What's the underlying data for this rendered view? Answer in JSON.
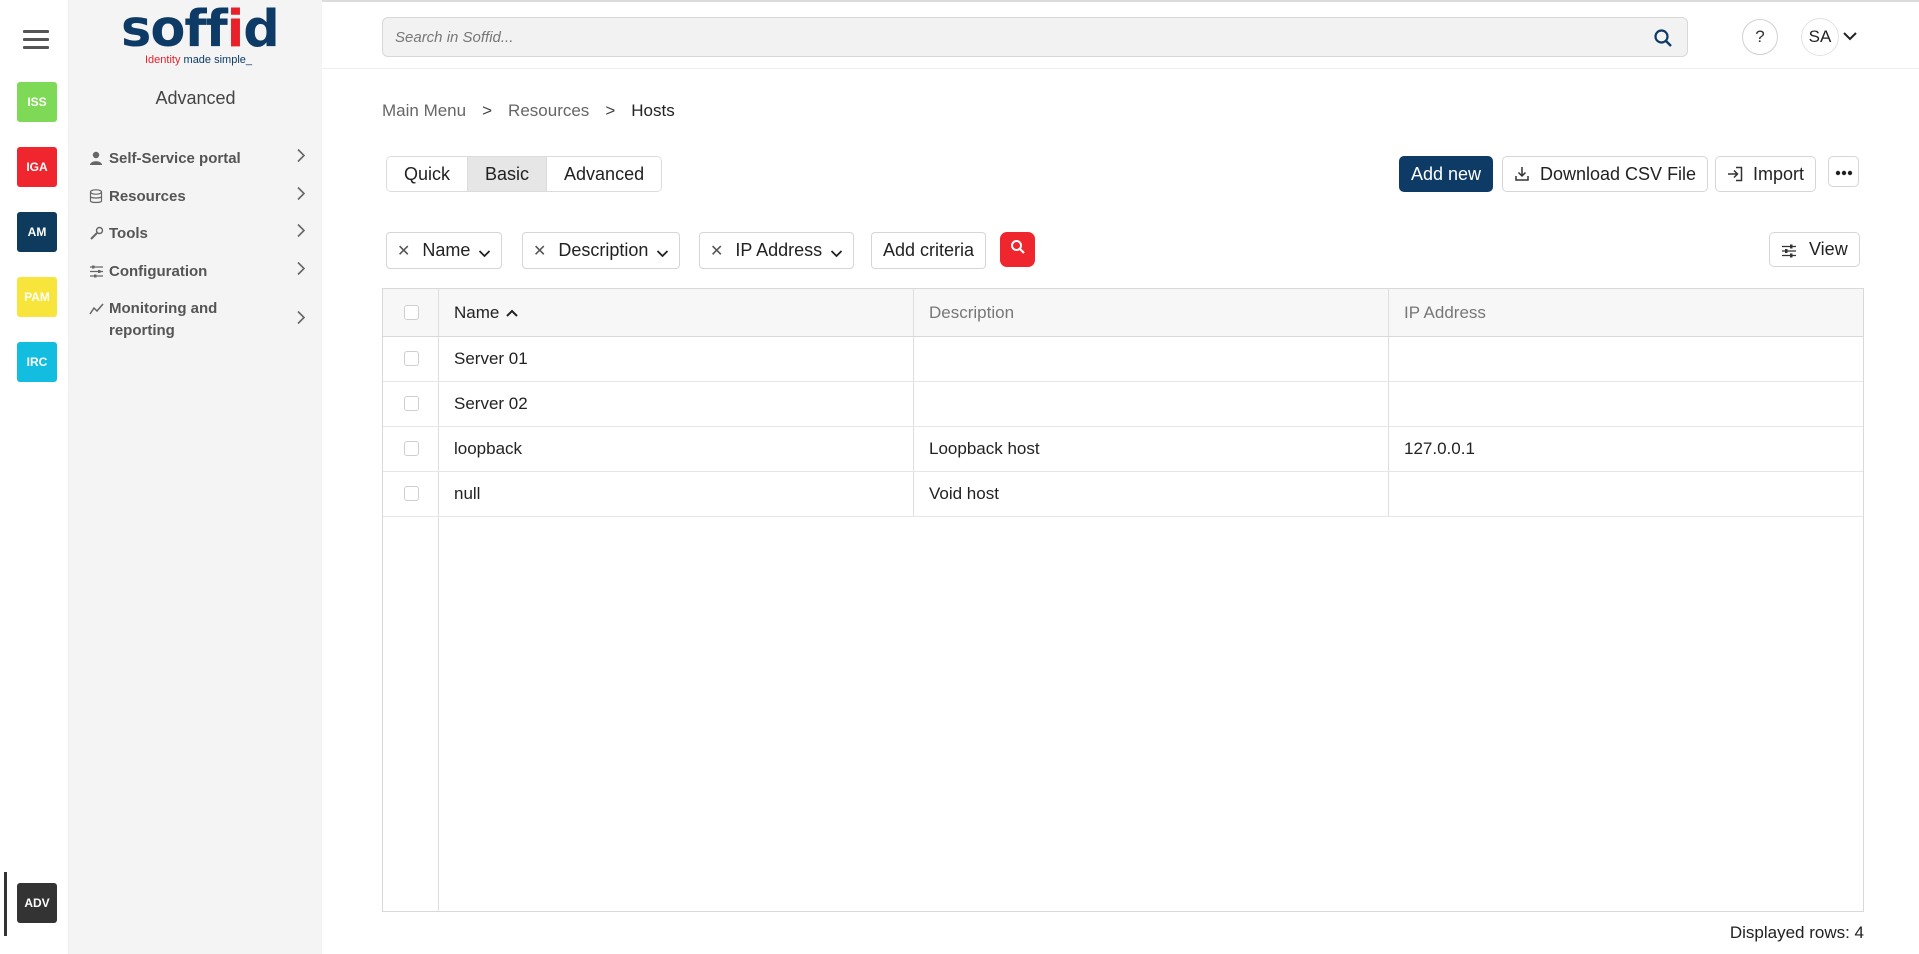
{
  "rail": {
    "modules": [
      {
        "code": "ISS",
        "color": "#7ed957"
      },
      {
        "code": "IGA",
        "color": "#f0262e"
      },
      {
        "code": "AM",
        "color": "#0e3a5e"
      },
      {
        "code": "PAM",
        "color": "#f7e53b"
      },
      {
        "code": "IRC",
        "color": "#12bde0"
      },
      {
        "code": "ADV",
        "color": "#333333"
      }
    ]
  },
  "brand": {
    "logo_left": "soff",
    "logo_i": "i",
    "logo_right": "d",
    "tagline_red": "Identity",
    "tagline_rest": " made simple_",
    "primary_color": "#0d3b66",
    "accent_color": "#e8202a"
  },
  "menu": {
    "title": "Advanced",
    "items": [
      {
        "label": "Self-Service portal",
        "icon": "person-icon"
      },
      {
        "label": "Resources",
        "icon": "database-icon"
      },
      {
        "label": "Tools",
        "icon": "wrench-icon"
      },
      {
        "label": "Configuration",
        "icon": "sliders-icon"
      },
      {
        "label": "Monitoring and reporting",
        "icon": "chart-line-icon"
      }
    ]
  },
  "topbar": {
    "search_placeholder": "Search in Soffid...",
    "help_label": "?",
    "user_initials": "SA"
  },
  "breadcrumb": {
    "items": [
      "Main Menu",
      "Resources"
    ],
    "separator": ">",
    "current": "Hosts"
  },
  "tabs": {
    "items": [
      "Quick",
      "Basic",
      "Advanced"
    ],
    "active": "Basic"
  },
  "actions": {
    "add_new": "Add new",
    "download_csv": "Download CSV File",
    "import": "Import"
  },
  "criteria": {
    "filters": [
      "Name",
      "Description",
      "IP Address"
    ],
    "add_criteria": "Add criteria",
    "view": "View"
  },
  "table": {
    "columns": [
      "Name",
      "Description",
      "IP Address"
    ],
    "sorted_column": "Name",
    "rows": [
      {
        "name": "Server 01",
        "description": "",
        "ip": ""
      },
      {
        "name": "Server 02",
        "description": "",
        "ip": ""
      },
      {
        "name": "loopback",
        "description": "Loopback host",
        "ip": "127.0.0.1"
      },
      {
        "name": "null",
        "description": "Void host",
        "ip": ""
      }
    ],
    "footer": "Displayed rows: 4"
  }
}
